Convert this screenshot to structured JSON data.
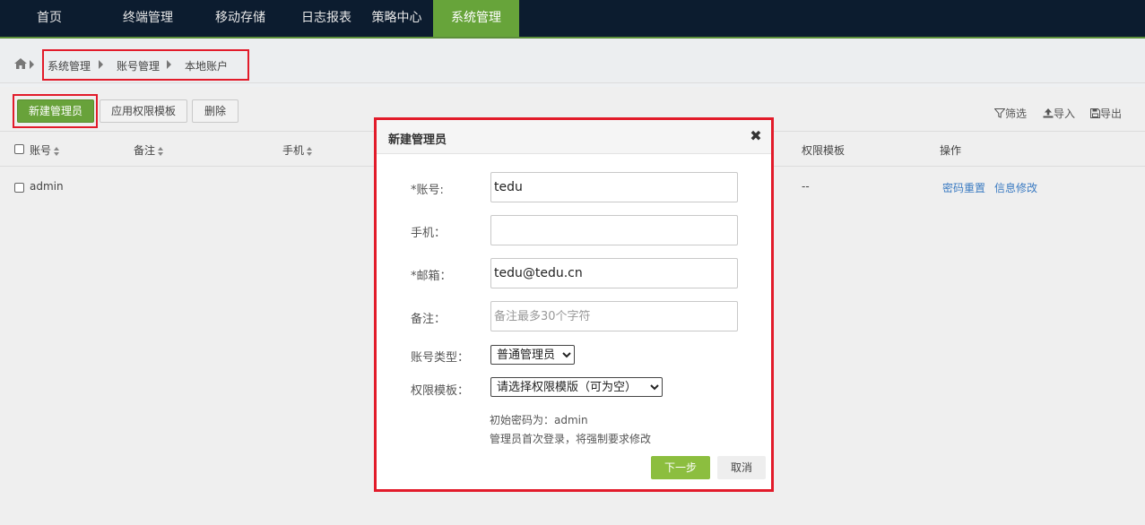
{
  "nav": {
    "items": [
      {
        "label": "首页"
      },
      {
        "label": "终端管理"
      },
      {
        "label": "移动存储"
      },
      {
        "label": "日志报表"
      },
      {
        "label": "策略中心"
      },
      {
        "label": "系统管理",
        "active": true
      }
    ]
  },
  "breadcrumb": {
    "items": [
      "系统管理",
      "账号管理",
      "本地账户"
    ]
  },
  "toolbar": {
    "new_admin_label": "新建管理员",
    "apply_template_label": "应用权限模板",
    "delete_label": "删除",
    "filter_label": "筛选",
    "import_label": "导入",
    "export_label": "导出"
  },
  "table": {
    "headers": {
      "account": "账号",
      "remark": "备注",
      "phone": "手机",
      "perm_template": "权限模板",
      "actions": "操作"
    },
    "rows": [
      {
        "account": "admin",
        "perm_template": "--",
        "action_reset": "密码重置",
        "action_edit": "信息修改"
      }
    ]
  },
  "modal": {
    "title": "新建管理员",
    "fields": {
      "account_label": "*账号:",
      "account_value": "tedu",
      "phone_label": "手机：",
      "phone_value": "",
      "email_label": "*邮箱：",
      "email_value": "tedu@tedu.cn",
      "remark_label": "备注：",
      "remark_placeholder": "备注最多30个字符",
      "type_label": "账号类型：",
      "type_selected": "普通管理员",
      "template_label": "权限模板：",
      "template_selected": "请选择权限模版（可为空）"
    },
    "hint_line1": "初始密码为：admin",
    "hint_line2": "管理员首次登录，将强制要求修改",
    "next_label": "下一步",
    "cancel_label": "取消"
  },
  "colors": {
    "nav_bg": "#0c1c2f",
    "accent_green": "#68a23a",
    "highlight_red": "#e21b2a",
    "link_blue": "#3b7bc2"
  }
}
